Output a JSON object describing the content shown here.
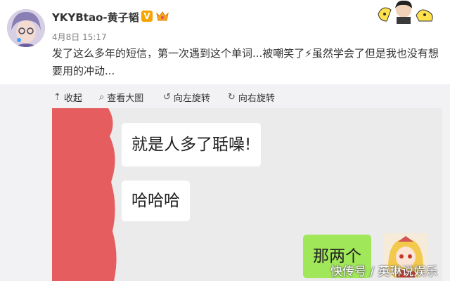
{
  "post": {
    "author": "YKYBtao-黄子韬",
    "verified_badge": "V",
    "time": "4月8日 15:17",
    "text": "发了这么多年的短信，第一次遇到这个单词...被嘲笑了⚡虽然学会了但是我也没有想要用的冲动..."
  },
  "toolbar": {
    "collapse": "收起",
    "view_large": "查看大图",
    "rotate_left": "向左旋转",
    "rotate_right": "向右旋转"
  },
  "chat": {
    "messages": [
      {
        "side": "left",
        "text": "就是人多了聒噪!"
      },
      {
        "side": "left",
        "text": "哈哈哈"
      },
      {
        "side": "right",
        "text": "那两个"
      }
    ]
  },
  "watermark": "快传号 / 英琳说娱乐",
  "colors": {
    "redaction": "#e55d5f",
    "bubble_right": "#a0e759",
    "badge": "#f7a400"
  }
}
